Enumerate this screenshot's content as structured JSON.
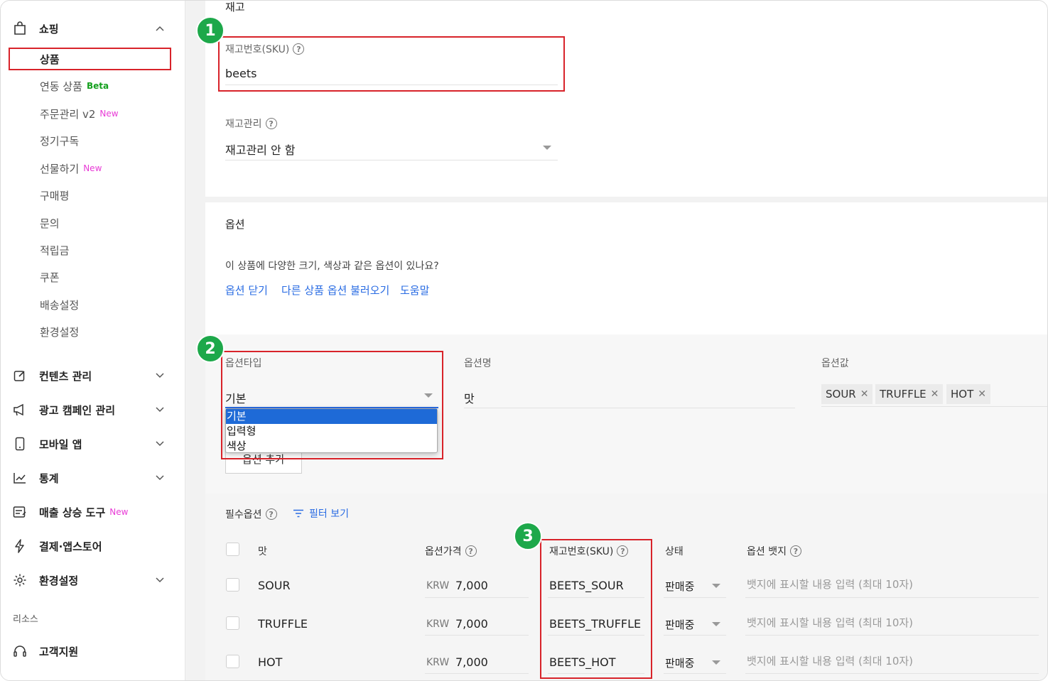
{
  "sidebar": {
    "shopping": {
      "label": "쇼핑",
      "icon": "shopping-bag-icon"
    },
    "sub_items": [
      {
        "label": "상품",
        "badge": ""
      },
      {
        "label": "연동 상품",
        "badge": "Beta"
      },
      {
        "label": "주문관리 v2",
        "badge": "New"
      },
      {
        "label": "정기구독",
        "badge": ""
      },
      {
        "label": "선물하기",
        "badge": "New"
      },
      {
        "label": "구매평",
        "badge": ""
      },
      {
        "label": "문의",
        "badge": ""
      },
      {
        "label": "적립금",
        "badge": ""
      },
      {
        "label": "쿠폰",
        "badge": ""
      },
      {
        "label": "배송설정",
        "badge": ""
      },
      {
        "label": "환경설정",
        "badge": ""
      }
    ],
    "groups": [
      {
        "label": "컨텐츠 관리",
        "icon": "edit-icon",
        "badge": ""
      },
      {
        "label": "광고 캠페인 관리",
        "icon": "megaphone-icon",
        "badge": ""
      },
      {
        "label": "모바일 앱",
        "icon": "mobile-icon",
        "badge": ""
      },
      {
        "label": "통계",
        "icon": "chart-icon",
        "badge": ""
      },
      {
        "label": "매출 상승 도구",
        "icon": "growth-tool-icon",
        "badge": "New"
      },
      {
        "label": "결제·앱스토어",
        "icon": "lightning-icon",
        "badge": ""
      },
      {
        "label": "환경설정",
        "icon": "gear-icon",
        "badge": ""
      }
    ],
    "resources_label": "리소스",
    "support_label": "고객지원"
  },
  "inventory": {
    "section_title": "재고",
    "sku_label": "재고번호(SKU)",
    "sku_value": "beets",
    "stock_label": "재고관리",
    "stock_value": "재고관리 안 함"
  },
  "options": {
    "section_title": "옵션",
    "question": "이 상품에 다양한 크기, 색상과 같은 옵션이 있나요?",
    "links": [
      "옵션 닫기",
      "다른 상품 옵션 불러오기",
      "도움말"
    ],
    "type_label": "옵션타입",
    "type_value": "기본",
    "type_options": [
      "기본",
      "입력형",
      "색상"
    ],
    "name_label": "옵션명",
    "name_value": "맛",
    "values_label": "옵션값",
    "values": [
      "SOUR",
      "TRUFFLE",
      "HOT"
    ],
    "add_button": "옵션 추가"
  },
  "required": {
    "label": "필수옵션",
    "filter_label": "필터 보기",
    "headers": {
      "name": "맛",
      "price": "옵션가격",
      "sku": "재고번호(SKU)",
      "status": "상태",
      "badge": "옵션 뱃지"
    },
    "currency": "KRW",
    "rows": [
      {
        "name": "SOUR",
        "price": "7,000",
        "sku": "BEETS_SOUR",
        "status": "판매중",
        "badge_placeholder": "뱃지에 표시할 내용 입력 (최대 10자)"
      },
      {
        "name": "TRUFFLE",
        "price": "7,000",
        "sku": "BEETS_TRUFFLE",
        "status": "판매중",
        "badge_placeholder": "뱃지에 표시할 내용 입력 (최대 10자)"
      },
      {
        "name": "HOT",
        "price": "7,000",
        "sku": "BEETS_HOT",
        "status": "판매중",
        "badge_placeholder": "뱃지에 표시할 내용 입력 (최대 10자)"
      }
    ]
  },
  "steps": [
    "1",
    "2",
    "3"
  ],
  "colors": {
    "accent": "#2a6ce3",
    "highlight": "#d8232a",
    "step": "#1da84a",
    "selected": "#1e6ad7"
  }
}
